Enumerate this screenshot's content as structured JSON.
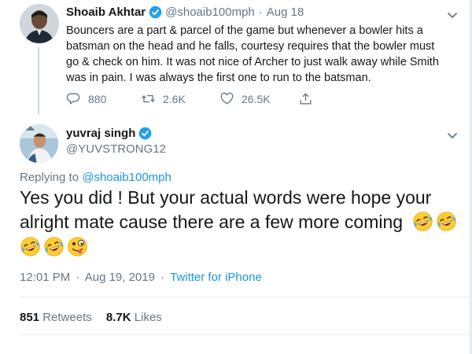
{
  "parent_tweet": {
    "name": "Shoaib Akhtar",
    "handle": "@shoaib100mph",
    "separator": "·",
    "date": "Aug 18",
    "text": "Bouncers are a part & parcel of the game but whenever a bowler hits a batsman on the head and he falls, courtesy requires that the bowler must go & check on him. It was not nice of Archer to just walk away while Smith was in pain. I was always the first one to run to the batsman.",
    "replies": "880",
    "retweets": "2.6K",
    "likes": "26.5K"
  },
  "main_tweet": {
    "name": "yuvraj singh",
    "handle": "@YUVSTRONG12",
    "replying_prefix": "Replying to",
    "replying_to": "@shoaib100mph",
    "text_line1": "Yes you did ! But your actual words were hope your",
    "text_line2": "alright mate cause there are a few more coming",
    "time": "12:01 PM",
    "separator": "·",
    "date": "Aug 19, 2019",
    "source": "Twitter for iPhone",
    "retweet_count": "851",
    "retweet_label": "Retweets",
    "like_count": "8.7K",
    "like_label": "Likes"
  },
  "colors": {
    "link": "#1b95e0",
    "muted": "#657786",
    "text": "#14171a",
    "divider": "#e6ecf0"
  },
  "icons": [
    "verified-badge-icon",
    "chevron-down-icon",
    "reply-icon",
    "retweet-icon",
    "like-icon",
    "share-icon",
    "laughing-crying-emoji",
    "zany-face-emoji"
  ]
}
